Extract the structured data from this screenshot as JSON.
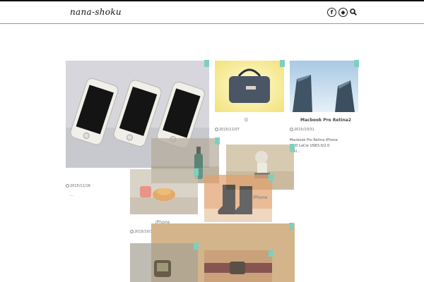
{
  "site": {
    "logo": "nana-shoku",
    "icons": [
      "facebook-icon",
      "feedly-icon",
      "search-icon"
    ],
    "facebook_glyph": "f",
    "feedly_glyph": "◆"
  },
  "posts": [
    {
      "key": "iphones",
      "date": "2015/11/16",
      "title": "",
      "excerpt": "..."
    },
    {
      "key": "bag",
      "date": "2015/11/07",
      "title": "()",
      "excerpt": ""
    },
    {
      "key": "macbook",
      "date": "2015/10/31",
      "title": "Macbook Pro Retina2",
      "excerpt_line1": "Macbook Pro Retina iPhone",
      "excerpt_line2": "HDD LaCie  USB3.0/2.0",
      "excerpt_line3": "Miki..."
    },
    {
      "key": "orange",
      "date": "2015/10/1",
      "title": "iPhone",
      "excerpt": ""
    },
    {
      "key": "boots",
      "title": "iPhone"
    },
    {
      "key": "ornament",
      "title": ""
    }
  ]
}
